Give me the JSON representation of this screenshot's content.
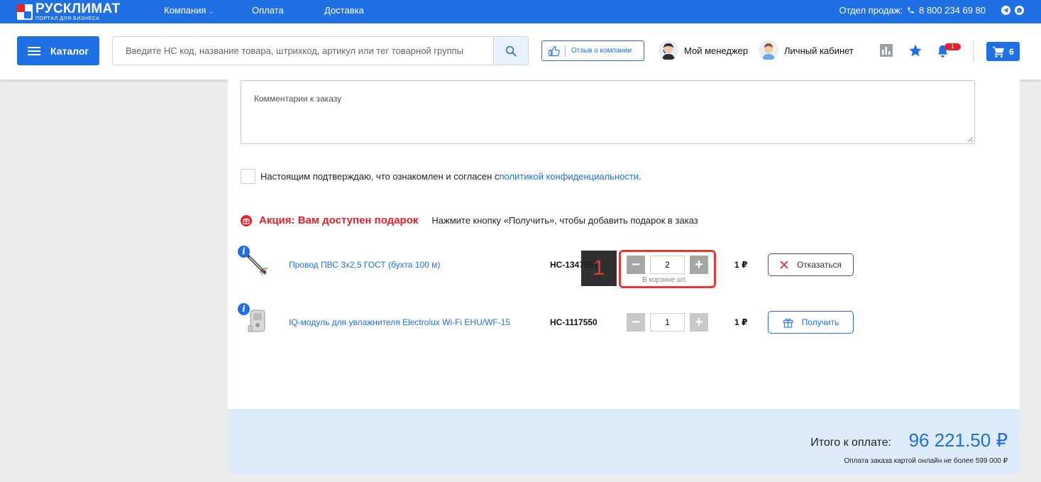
{
  "brand": {
    "title": "РУСКЛИМАТ",
    "subtitle": "ПОРТАЛ ДЛЯ БИЗНЕСА",
    "accent": "#1f6fe5",
    "red": "#e5212b"
  },
  "topnav": {
    "company": "Компания",
    "payment": "Оплата",
    "delivery": "Доставка"
  },
  "sales": {
    "label": "Отдел продаж:",
    "phone": "8 800 234 69 80"
  },
  "header": {
    "catalog": "Каталог",
    "search_placeholder": "Введите НС код, название товара, штрихкод, артикул или тег товарной группы",
    "review": "Отзыв о компании",
    "manager": "Мой менеджер",
    "account": "Личный кабинет",
    "notifications_count": "1",
    "cart_count": "6"
  },
  "order": {
    "comment_placeholder": "Комментарии к заказу",
    "consent_text": "Настоящим подтверждаю, что ознакомлен и согласен с ",
    "consent_link": "политикой конфиденциальности",
    "consent_end": "."
  },
  "promo": {
    "title": "Акция: Вам доступен подарок",
    "hint": "Нажмите кнопку «Получить», чтобы добавить подарок в заказ",
    "cart_note": "В корзине шт.",
    "items": [
      {
        "name": "Провод ПВС 3х2,5 ГОСТ (бухта 100 м)",
        "code": "НС-1347651",
        "qty": "2",
        "price": "1 ₽",
        "action": "Отказаться"
      },
      {
        "name": "IQ-модуль для увлажнителя Electrolux Wi-Fi EHU/WF-15",
        "code": "НС-1117550",
        "qty": "1",
        "price": "1 ₽",
        "action": "Получить"
      }
    ]
  },
  "callout": {
    "number": "1"
  },
  "total": {
    "label": "Итого к оплате:",
    "value": "96 221.50 ₽",
    "note": "Оплата заказа картой онлайн не более 599 000 ₽"
  }
}
